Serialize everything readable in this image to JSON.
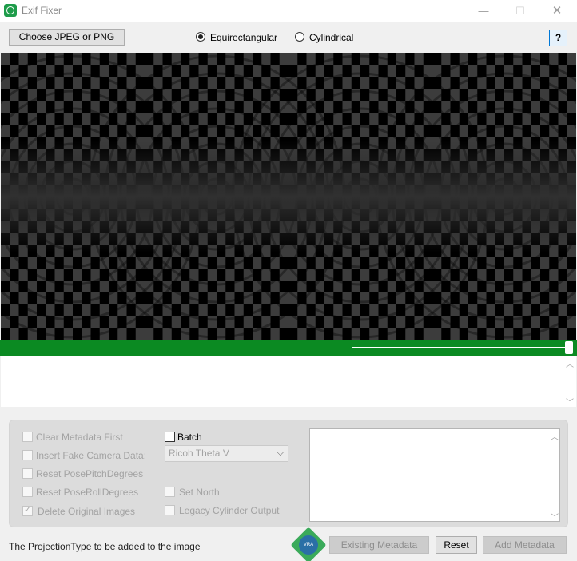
{
  "window": {
    "title": "Exif Fixer",
    "minimize": "—",
    "maximize": "☐",
    "close": "✕"
  },
  "toolbar": {
    "choose_label": "Choose JPEG or PNG",
    "projection_options": [
      {
        "label": "Equirectangular",
        "selected": true
      },
      {
        "label": "Cylindrical",
        "selected": false
      }
    ],
    "help_label": "?"
  },
  "progress": {
    "value_percent": 99
  },
  "options": {
    "clear_metadata": {
      "label": "Clear Metadata First",
      "checked": false,
      "enabled": false
    },
    "batch": {
      "label": "Batch",
      "checked": false,
      "enabled": true
    },
    "fake_camera": {
      "label": "Insert Fake Camera Data:",
      "checked": false,
      "enabled": false
    },
    "camera_select": {
      "value": "Ricoh Theta V"
    },
    "reset_pitch": {
      "label": "Reset PosePitchDegrees",
      "checked": false,
      "enabled": false
    },
    "reset_roll": {
      "label": "Reset PoseRollDegrees",
      "checked": false,
      "enabled": false
    },
    "set_north": {
      "label": "Set North",
      "checked": false,
      "enabled": false
    },
    "delete_originals": {
      "label": "Delete Original Images",
      "checked": true,
      "enabled": false
    },
    "legacy_cylinder": {
      "label": "Legacy Cylinder Output",
      "checked": false,
      "enabled": false
    }
  },
  "status": {
    "text": "The ProjectionType to be added to the image",
    "logo_text": "VRA"
  },
  "buttons": {
    "existing_metadata": "Existing Metadata",
    "reset": "Reset",
    "add_metadata": "Add Metadata"
  },
  "colors": {
    "progress_green": "#0b8a22",
    "checker_light": "#3c3c3c",
    "checker_dark": "#000000"
  }
}
